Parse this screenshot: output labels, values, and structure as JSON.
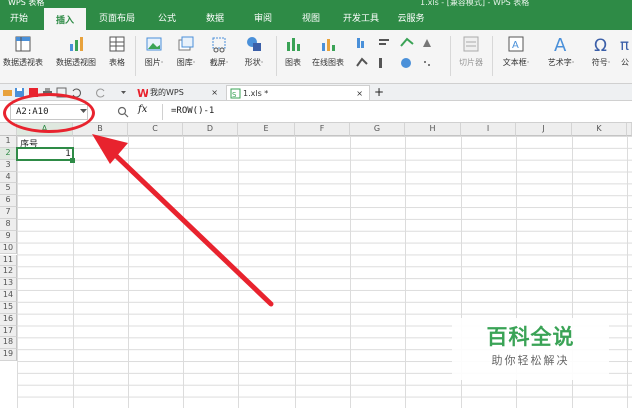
{
  "window": {
    "app_title": "WPS 表格",
    "doc_title": "1.xls - [兼容模式] - WPS 表格"
  },
  "menu": {
    "tabs": [
      "开始",
      "插入",
      "页面布局",
      "公式",
      "数据",
      "审阅",
      "视图",
      "开发工具",
      "云服务"
    ],
    "active": "插入"
  },
  "ribbon": {
    "buttons": [
      "数据透视表",
      "数据透视图",
      "表格",
      "图片·",
      "图库·",
      "截屏·",
      "形状·",
      "图表",
      "在线图表",
      "切片器",
      "文本框·",
      "艺术字·",
      "符号·",
      "公"
    ]
  },
  "quickbar": {
    "tab_wps": "我的WPS",
    "tab_file": "1.xls *",
    "add": "+",
    "close": "×"
  },
  "formula_bar": {
    "name_box": "A2:A10",
    "fx": "fx",
    "formula": "=ROW()-1",
    "zoom_icon": "magnifier-icon"
  },
  "sheet": {
    "columns": [
      "A",
      "B",
      "C",
      "D",
      "E",
      "F",
      "G",
      "H",
      "I",
      "J",
      "K"
    ],
    "rows": [
      "1",
      "2",
      "3",
      "4",
      "5",
      "6",
      "7",
      "8",
      "9",
      "10",
      "11",
      "12",
      "13",
      "14",
      "15",
      "16",
      "17",
      "18",
      "19"
    ],
    "cells": {
      "A1": "序号",
      "A2": "1"
    }
  },
  "watermark": {
    "title": "百科全说",
    "subtitle": "助你轻松解决"
  },
  "colors": {
    "accent": "#2e8b46",
    "annotation": "#e8232e"
  }
}
